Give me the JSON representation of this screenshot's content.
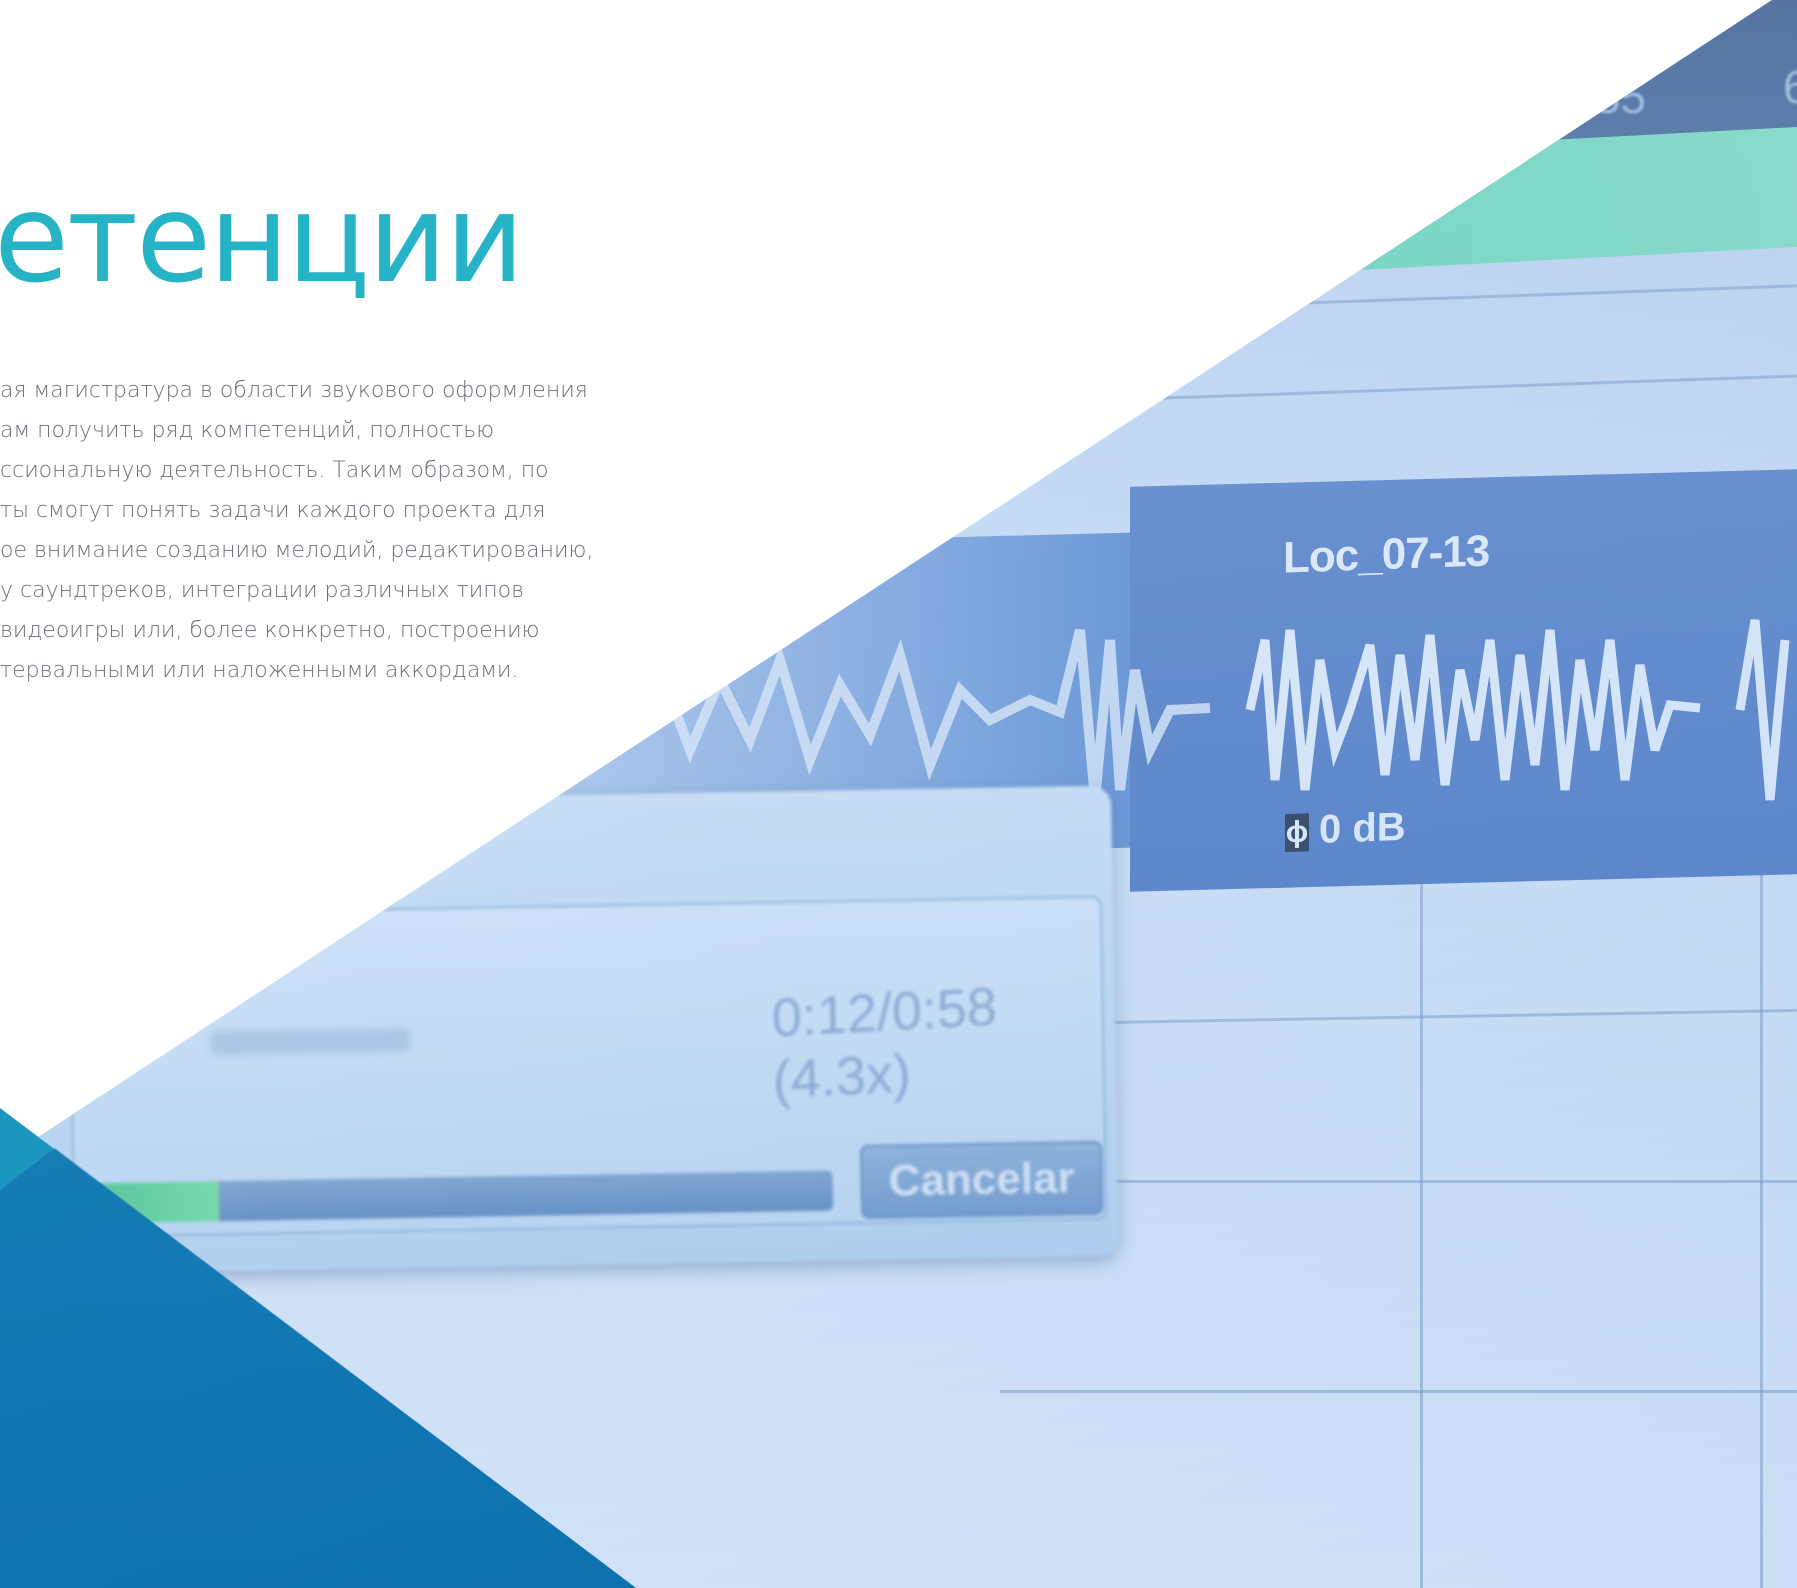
{
  "heading": {
    "title": "етенции"
  },
  "body": {
    "lines": [
      "ая магистратура в области звукового оформления",
      "ам получить ряд компетенций, полностью",
      "ссиональную деятельность. Таким образом, по",
      "ты смогут понять задачи каждого проекта для",
      "ое внимание созданию мелодий, редактированию,",
      "у саундтреков, интеграции различных типов",
      "видеоигры или, более конкретно, построению",
      "тервальными или наложенными аккордами."
    ]
  },
  "photo": {
    "top_readout_1": ".55",
    "top_readout_2": "6",
    "clip_name": "Loc_07-13",
    "gain": "0 dB",
    "gain_icon": "phase-icon",
    "dialog": {
      "time_readout": "0:12/0:58 (4.3x)",
      "cancel_label": "Cancelar",
      "progress_fraction": 0.17
    }
  },
  "colors": {
    "title": "#26b3c5",
    "body_text": "#6a6f78",
    "accent_teal": "#1a91bf"
  }
}
